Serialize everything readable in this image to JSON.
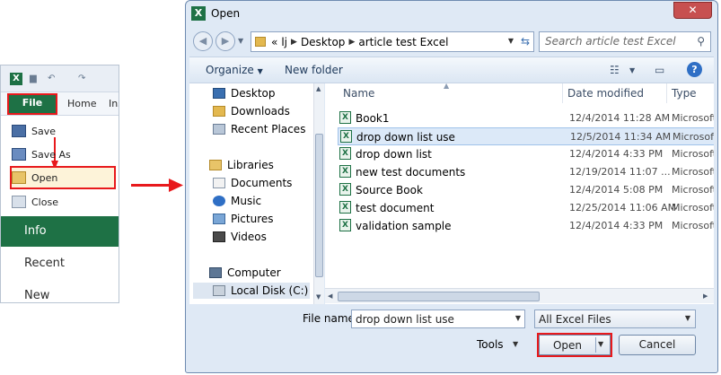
{
  "excel": {
    "logo_letter": "X",
    "qat_undo": "↶",
    "qat_redo": "↷",
    "file_tab": "File",
    "home_tab": "Home",
    "insert_tab_partial": "Ins",
    "backstage": {
      "save": "Save",
      "save_as": "Save As",
      "open": "Open",
      "close": "Close",
      "info": "Info",
      "recent": "Recent",
      "new": "New"
    }
  },
  "dialog": {
    "title": "Open",
    "logo_letter": "X",
    "close_glyph": "✕",
    "back_glyph": "◀",
    "forward_glyph": "▶",
    "breadcrumb_prefix": "«",
    "breadcrumb": [
      "lj",
      "Desktop",
      "article test Excel"
    ],
    "search_placeholder": "Search article test Excel",
    "toolbar": {
      "organize": "Organize",
      "new_folder": "New folder"
    },
    "nav": {
      "favorites": [
        "Desktop",
        "Downloads",
        "Recent Places"
      ],
      "libraries_header": "Libraries",
      "libraries": [
        "Documents",
        "Music",
        "Pictures",
        "Videos"
      ],
      "computer_header": "Computer",
      "local_disk": "Local Disk (C:)"
    },
    "columns": {
      "name": "Name",
      "date_modified": "Date modified",
      "type": "Type"
    },
    "files": [
      {
        "name": "Book1",
        "date": "12/4/2014 11:28 AM",
        "type": "Microsoft"
      },
      {
        "name": "drop down list use",
        "date": "12/5/2014 11:34 AM",
        "type": "Microsoft"
      },
      {
        "name": "drop down list",
        "date": "12/4/2014 4:33 PM",
        "type": "Microsoft"
      },
      {
        "name": "new test documents",
        "date": "12/19/2014 11:07 ...",
        "type": "Microsoft"
      },
      {
        "name": "Source Book",
        "date": "12/4/2014 5:08 PM",
        "type": "Microsoft"
      },
      {
        "name": "test document",
        "date": "12/25/2014 11:06 AM",
        "type": "Microsoft"
      },
      {
        "name": "validation sample",
        "date": "12/4/2014 4:33 PM",
        "type": "Microsoft"
      }
    ],
    "file_name_label": "File name:",
    "file_name_value": "drop down list use",
    "file_type_value": "All Excel Files",
    "tools_label": "Tools",
    "open_button": "Open",
    "cancel_button": "Cancel"
  },
  "colors": {
    "excel_green": "#1e7145",
    "highlight_red": "#e8191c",
    "dialog_bg": "#dfe9f5",
    "selection_blue": "#dce9f8"
  }
}
